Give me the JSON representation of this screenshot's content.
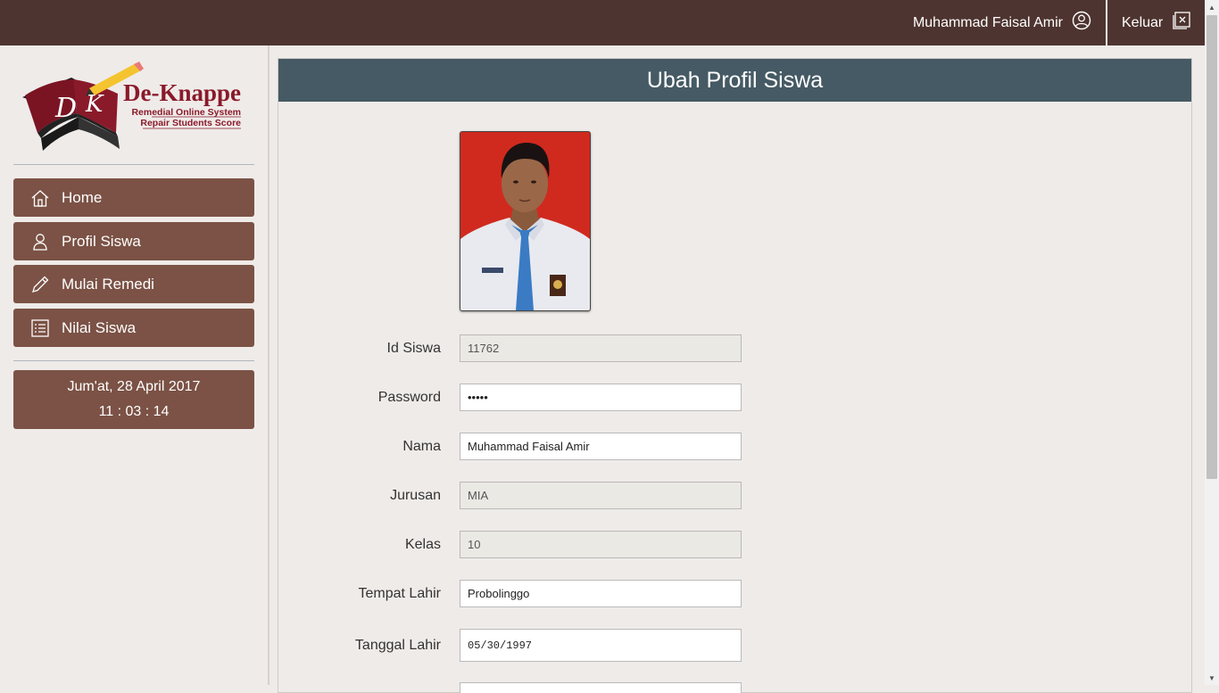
{
  "topbar": {
    "user_name": "Muhammad Faisal Amir",
    "logout_label": "Keluar"
  },
  "logo": {
    "monogram_left": "D",
    "monogram_right": "K",
    "brand": "De-Knappe",
    "tagline1": "Remedial Online System",
    "tagline2": "Repair Students Score"
  },
  "sidebar": {
    "items": [
      {
        "label": "Home",
        "icon": "home-icon"
      },
      {
        "label": "Profil Siswa",
        "icon": "user-icon"
      },
      {
        "label": "Mulai Remedi",
        "icon": "pencil-icon"
      },
      {
        "label": "Nilai Siswa",
        "icon": "list-icon"
      }
    ],
    "clock": {
      "date": "Jum'at, 28 April 2017",
      "time": "11 : 03 : 14"
    }
  },
  "panel": {
    "title": "Ubah Profil Siswa"
  },
  "form": {
    "id_siswa": {
      "label": "Id Siswa",
      "value": "11762"
    },
    "password": {
      "label": "Password",
      "value": "•••••"
    },
    "nama": {
      "label": "Nama",
      "value": "Muhammad Faisal Amir"
    },
    "jurusan": {
      "label": "Jurusan",
      "value": "MIA"
    },
    "kelas": {
      "label": "Kelas",
      "value": "10"
    },
    "tempat_lahir": {
      "label": "Tempat Lahir",
      "value": "Probolinggo"
    },
    "tanggal_lahir": {
      "label": "Tanggal Lahir",
      "value": "05/30/1997"
    }
  },
  "colors": {
    "topbar": "#4e3430",
    "menu": "#7b5245",
    "panel_header": "#455a64",
    "background": "#efebe9"
  }
}
